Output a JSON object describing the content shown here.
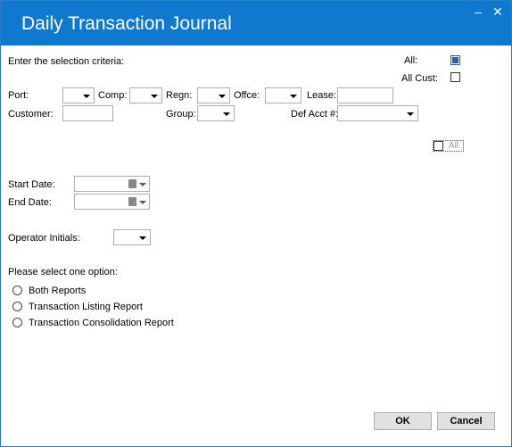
{
  "window": {
    "title": "Daily Transaction Journal",
    "minimize_label": "–",
    "close_label": "✕"
  },
  "criteria": {
    "heading": "Enter the selection criteria:",
    "all_label": "All:",
    "all_checked": true,
    "all_cust_label": "All Cust:",
    "all_cust_checked": false,
    "port_label": "Port:",
    "comp_label": "Comp:",
    "regn_label": "Regn:",
    "offce_label": "Offce:",
    "lease_label": "Lease:",
    "customer_label": "Customer:",
    "group_label": "Group:",
    "def_acct_label": "Def Acct #:",
    "all_small_label": "All",
    "all_small_checked": false
  },
  "dates": {
    "start_label": "Start Date:",
    "end_label": "End Date:",
    "start_value": "",
    "end_value": ""
  },
  "operator": {
    "label": "Operator Initials:"
  },
  "options": {
    "heading": "Please select one option:",
    "items": [
      {
        "label": "Both Reports",
        "selected": false
      },
      {
        "label": "Transaction Listing Report",
        "selected": false
      },
      {
        "label": "Transaction Consolidation Report",
        "selected": false
      }
    ]
  },
  "buttons": {
    "ok": "OK",
    "cancel": "Cancel"
  },
  "colors": {
    "titlebar": "#0f79d0",
    "checkbox_fill": "#1f62b0"
  }
}
